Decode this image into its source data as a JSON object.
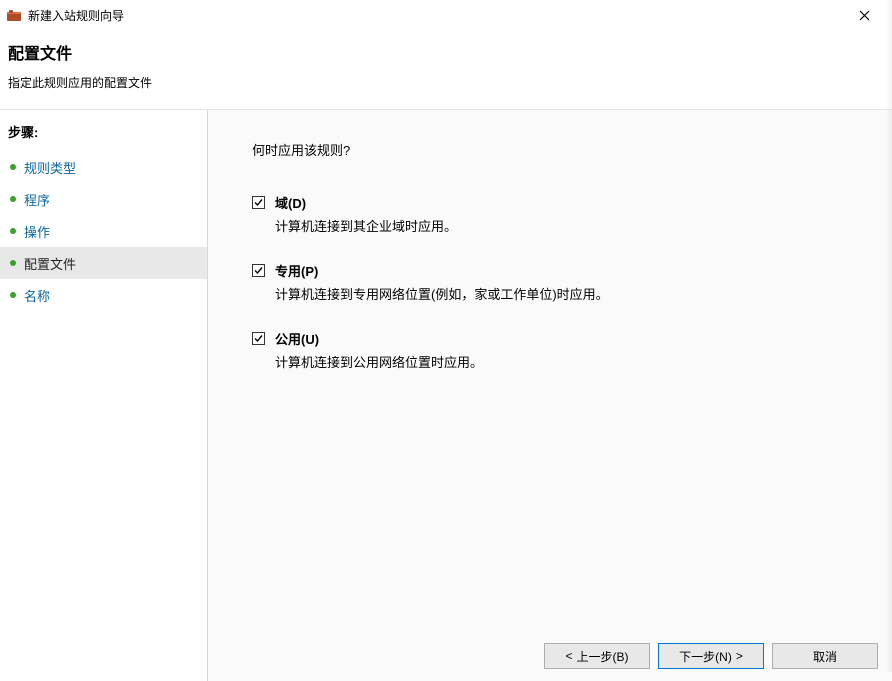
{
  "window": {
    "title": "新建入站规则向导"
  },
  "header": {
    "title": "配置文件",
    "subtitle": "指定此规则应用的配置文件"
  },
  "sidebar": {
    "steps_label": "步骤:",
    "items": [
      {
        "label": "规则类型"
      },
      {
        "label": "程序"
      },
      {
        "label": "操作"
      },
      {
        "label": "配置文件"
      },
      {
        "label": "名称"
      }
    ]
  },
  "content": {
    "prompt": "何时应用该规则?",
    "checkboxes": [
      {
        "label": "域(D)",
        "desc": "计算机连接到其企业域时应用。",
        "checked": true
      },
      {
        "label": "专用(P)",
        "desc": "计算机连接到专用网络位置(例如，家或工作单位)时应用。",
        "checked": true
      },
      {
        "label": "公用(U)",
        "desc": "计算机连接到公用网络位置时应用。",
        "checked": true
      }
    ]
  },
  "footer": {
    "back": "上一步(B)",
    "next": "下一步(N)",
    "cancel": "取消"
  }
}
